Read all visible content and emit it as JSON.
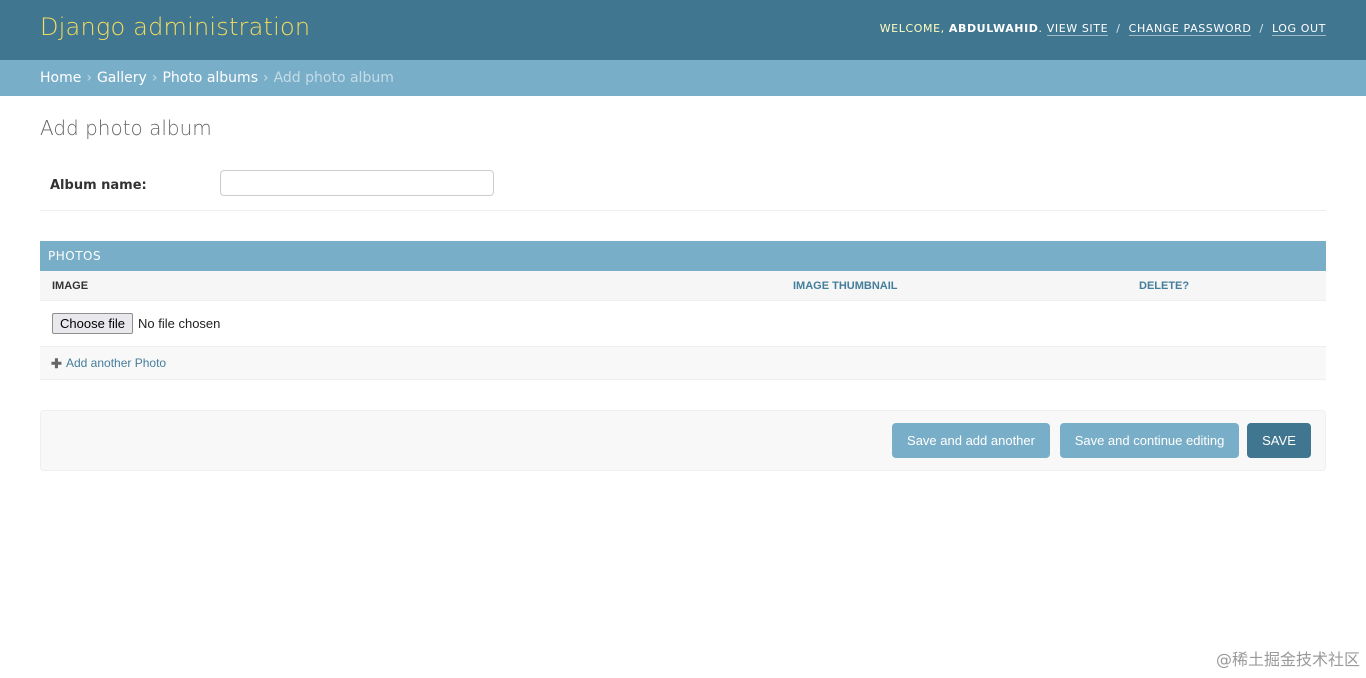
{
  "header": {
    "brand": "Django administration",
    "welcome": "Welcome,",
    "username": "ABDULWAHID",
    "view_site": "View site",
    "change_password": "Change password",
    "log_out": "Log out",
    "separator": "/"
  },
  "breadcrumbs": {
    "items": [
      "Home",
      "Gallery",
      "Photo albums"
    ],
    "current": "Add photo album",
    "separator": "›"
  },
  "page": {
    "title": "Add photo album"
  },
  "form": {
    "album_name_label": "Album name:",
    "album_name_value": "",
    "album_name_placeholder": ""
  },
  "inline": {
    "title": "PHOTOS",
    "columns": [
      "IMAGE",
      "IMAGE THUMBNAIL",
      "DELETE?"
    ],
    "file_button": "Choose file",
    "file_status": "No file chosen",
    "add_another": "Add another Photo"
  },
  "submit": {
    "save_add_another": "Save and add another",
    "save_continue": "Save and continue editing",
    "save": "SAVE"
  },
  "watermark": "@稀土掘金技术社区",
  "colors": {
    "header_bg": "#417690",
    "brand": "#f5dd5d",
    "breadcrumb_bg": "#79aec8",
    "link": "#447e9b",
    "save_button": "#417690",
    "secondary_button": "#79aec8"
  },
  "icons": {
    "add_another": "plus-icon"
  }
}
